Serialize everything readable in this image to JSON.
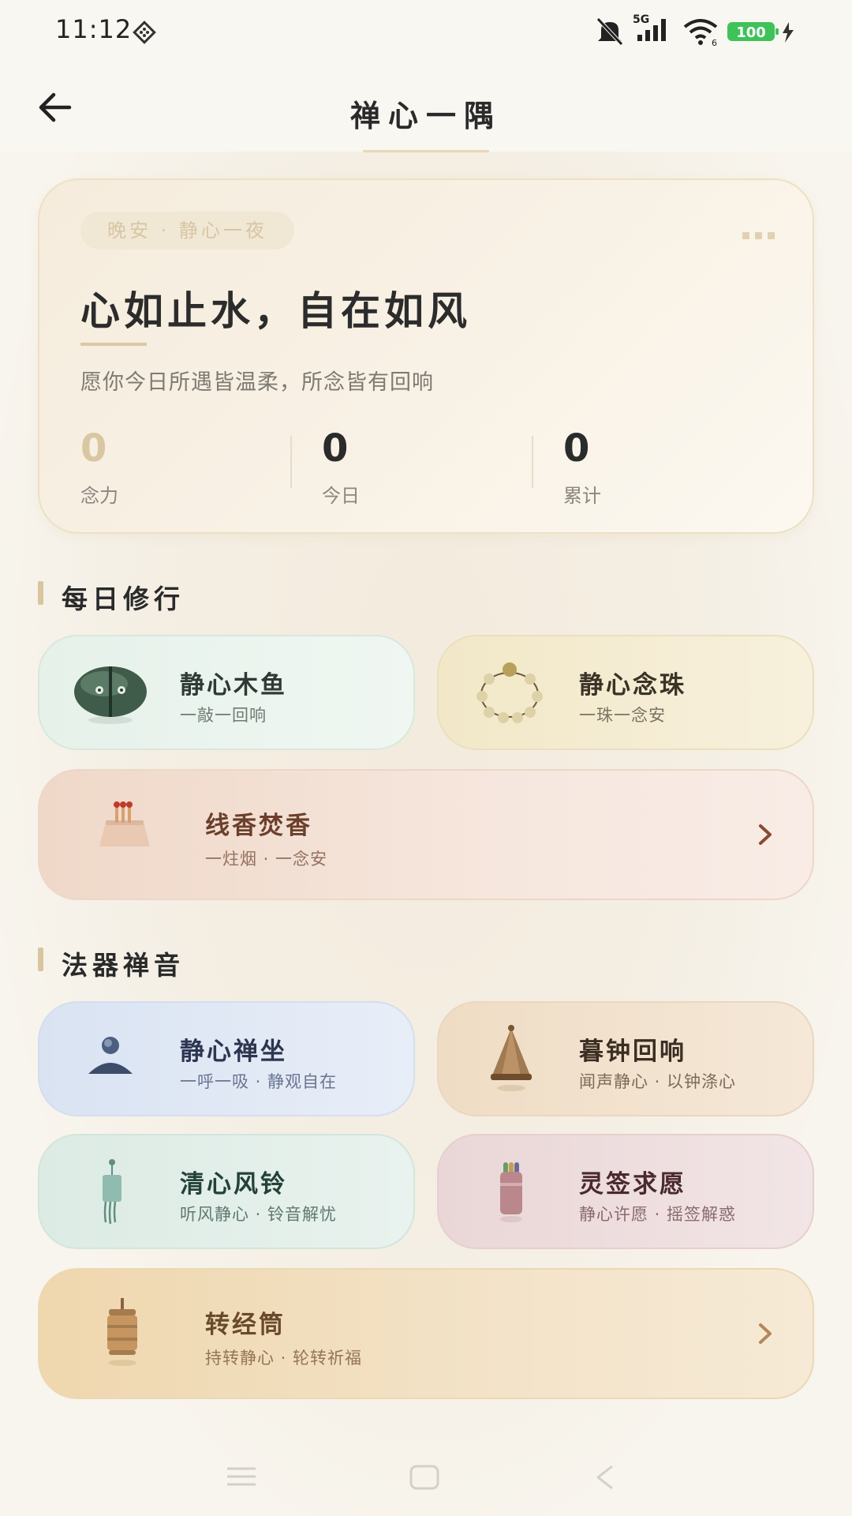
{
  "status_bar": {
    "time": "11:12",
    "network": "5G",
    "battery": "100",
    "wifi_sub": "6"
  },
  "app_bar": {
    "title": "禅心一隅",
    "back_icon": "arrow-left-icon"
  },
  "hero": {
    "greeting": "晚安 · 静心一夜",
    "headline": "心如止水，自在如风",
    "subline": "愿你今日所遇皆温柔，所念皆有回响",
    "stats": [
      {
        "value": "0",
        "label": "念力"
      },
      {
        "value": "0",
        "label": "今日"
      },
      {
        "value": "0",
        "label": "累计"
      }
    ]
  },
  "sections": {
    "daily": "每日修行",
    "instruments": "法器禅音"
  },
  "tools": {
    "muyu": {
      "title": "静心木鱼",
      "subtitle": "一敲一回响",
      "icon": "wooden-fish-icon"
    },
    "beads": {
      "title": "静心念珠",
      "subtitle": "一珠一念安",
      "icon": "prayer-beads-icon"
    },
    "incense": {
      "title": "线香焚香",
      "subtitle": "一炷烟 · 一念安",
      "icon": "incense-icon"
    },
    "zazen": {
      "title": "静心禅坐",
      "subtitle": "一呼一吸 · 静观自在",
      "icon": "meditation-icon"
    },
    "bell": {
      "title": "暮钟回响",
      "subtitle": "闻声静心 · 以钟涤心",
      "icon": "bell-icon"
    },
    "chime": {
      "title": "清心风铃",
      "subtitle": "听风静心 · 铃音解忧",
      "icon": "wind-chime-icon"
    },
    "lots": {
      "title": "灵签求愿",
      "subtitle": "静心许愿 · 摇签解惑",
      "icon": "fortune-sticks-icon"
    },
    "wheel": {
      "title": "转经筒",
      "subtitle": "持转静心 · 轮转祈福",
      "icon": "prayer-wheel-icon"
    }
  },
  "colors": {
    "gold": "#d9c6a0",
    "text_dark": "#2b2b2b",
    "incense_text": "#6b3f2b",
    "wheel_text": "#6a4a2c"
  }
}
